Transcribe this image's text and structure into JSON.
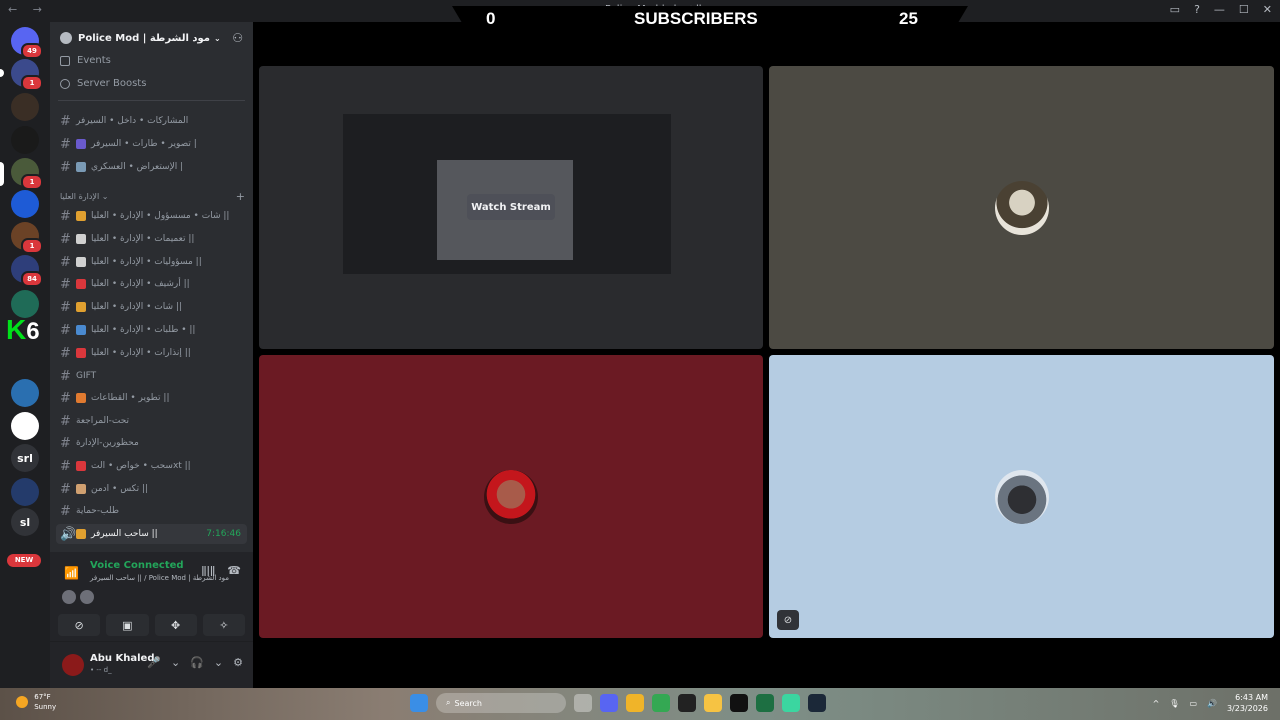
{
  "titlebar": {
    "back": "←",
    "forward": "→",
    "window_title": "Police Mod | مود الشرطة",
    "icons": [
      "screen-share-icon",
      "help-icon",
      "minimize-icon",
      "maximize-icon",
      "close-icon"
    ]
  },
  "overlay": {
    "left_count": "0",
    "title": "SUBSCRIBERS",
    "right_count": "25"
  },
  "rail": {
    "servers": [
      {
        "name": "discord-home",
        "badge": "49",
        "color": "#5865f2"
      },
      {
        "name": "server-2",
        "badge": "1",
        "color": "#3b4a8c"
      },
      {
        "name": "server-3",
        "badge": "",
        "color": "#3a2e25"
      },
      {
        "name": "server-4",
        "badge": "",
        "color": "#1a1a1a"
      },
      {
        "name": "server-5",
        "badge": "1",
        "color": "#4a5a3a"
      },
      {
        "name": "server-6",
        "badge": "",
        "color": "#1e5bd6"
      },
      {
        "name": "server-7",
        "badge": "1",
        "color": "#6b4226"
      },
      {
        "name": "server-8",
        "badge": "84",
        "color": "#2e3e7a"
      },
      {
        "name": "server-9",
        "badge": "",
        "color": "#1f6b57"
      },
      {
        "name": "server-10",
        "badge": "",
        "color": "#2a6fb0"
      },
      {
        "name": "server-11",
        "badge": "",
        "color": "#ffffff"
      },
      {
        "name": "server-srl",
        "badge": "",
        "color": "#313338",
        "label": "srl"
      },
      {
        "name": "server-12",
        "badge": "",
        "color": "#243b6b"
      },
      {
        "name": "server-sl",
        "badge": "",
        "color": "#313338",
        "label": "sl"
      }
    ],
    "new_badge": "NEW",
    "k6_k": "K",
    "k6_six": "6"
  },
  "sidebar": {
    "guild_name": "Police Mod | مود الشرطة",
    "events": "Events",
    "server_boosts": "Server Boosts",
    "category": "الإدارة العليا",
    "channels": [
      {
        "name": "المشاركات • داخل • السيرفر",
        "emoji": ""
      },
      {
        "name": "تصوير • طارات • السيرفر |",
        "emoji": "#6a5acd"
      },
      {
        "name": "الإستعراض • العسكري |",
        "emoji": "#7a9ab5"
      },
      {
        "name": "شات • مسسؤول • الإدارة • العليا ||",
        "emoji": "#e0a030"
      },
      {
        "name": "تعميمات • الإدارة • العليا ||",
        "emoji": "#d0d0d0"
      },
      {
        "name": "مسؤوليات • الإدارة • العليا ||",
        "emoji": "#d0d0d0"
      },
      {
        "name": "أرشيف • الإدارة • العليا ||",
        "emoji": "#da373c"
      },
      {
        "name": "شات • الإدارة • العليا ||",
        "emoji": "#e0a030"
      },
      {
        "name": "طلبات • الإدارة • العليا • ||",
        "emoji": "#4a8ad0"
      },
      {
        "name": "إنذارات • الإدارة • العليا ||",
        "emoji": "#da373c"
      },
      {
        "name": "GIFT",
        "emoji": ""
      },
      {
        "name": "تطوير • القطاعات ||",
        "emoji": "#e07a30"
      },
      {
        "name": "تحت-المراجعة",
        "emoji": ""
      },
      {
        "name": "محظورين-الإدارة",
        "emoji": ""
      },
      {
        "name": "سحب • خواص • التxt ||",
        "emoji": "#da373c"
      },
      {
        "name": "تكس • ادمن ||",
        "emoji": "#d0a070"
      },
      {
        "name": "طلب-حماية",
        "emoji": ""
      }
    ],
    "active_channel": {
      "name": "ساحب السيرفر ||",
      "time": "7:16:46",
      "emoji": "#e0a030"
    }
  },
  "voice": {
    "status": "Voice Connected",
    "channel": "ساحب السيرفر || / Police Mod | مود الشرطة"
  },
  "user": {
    "name": "Abu Khaled",
    "status": "• -- d_"
  },
  "stage": {
    "watch_stream": "Watch Stream"
  },
  "taskbar": {
    "temp": "67°F",
    "weather": "Sunny",
    "search": "Search",
    "time": "6:43 AM",
    "date": "3/23/2026"
  }
}
